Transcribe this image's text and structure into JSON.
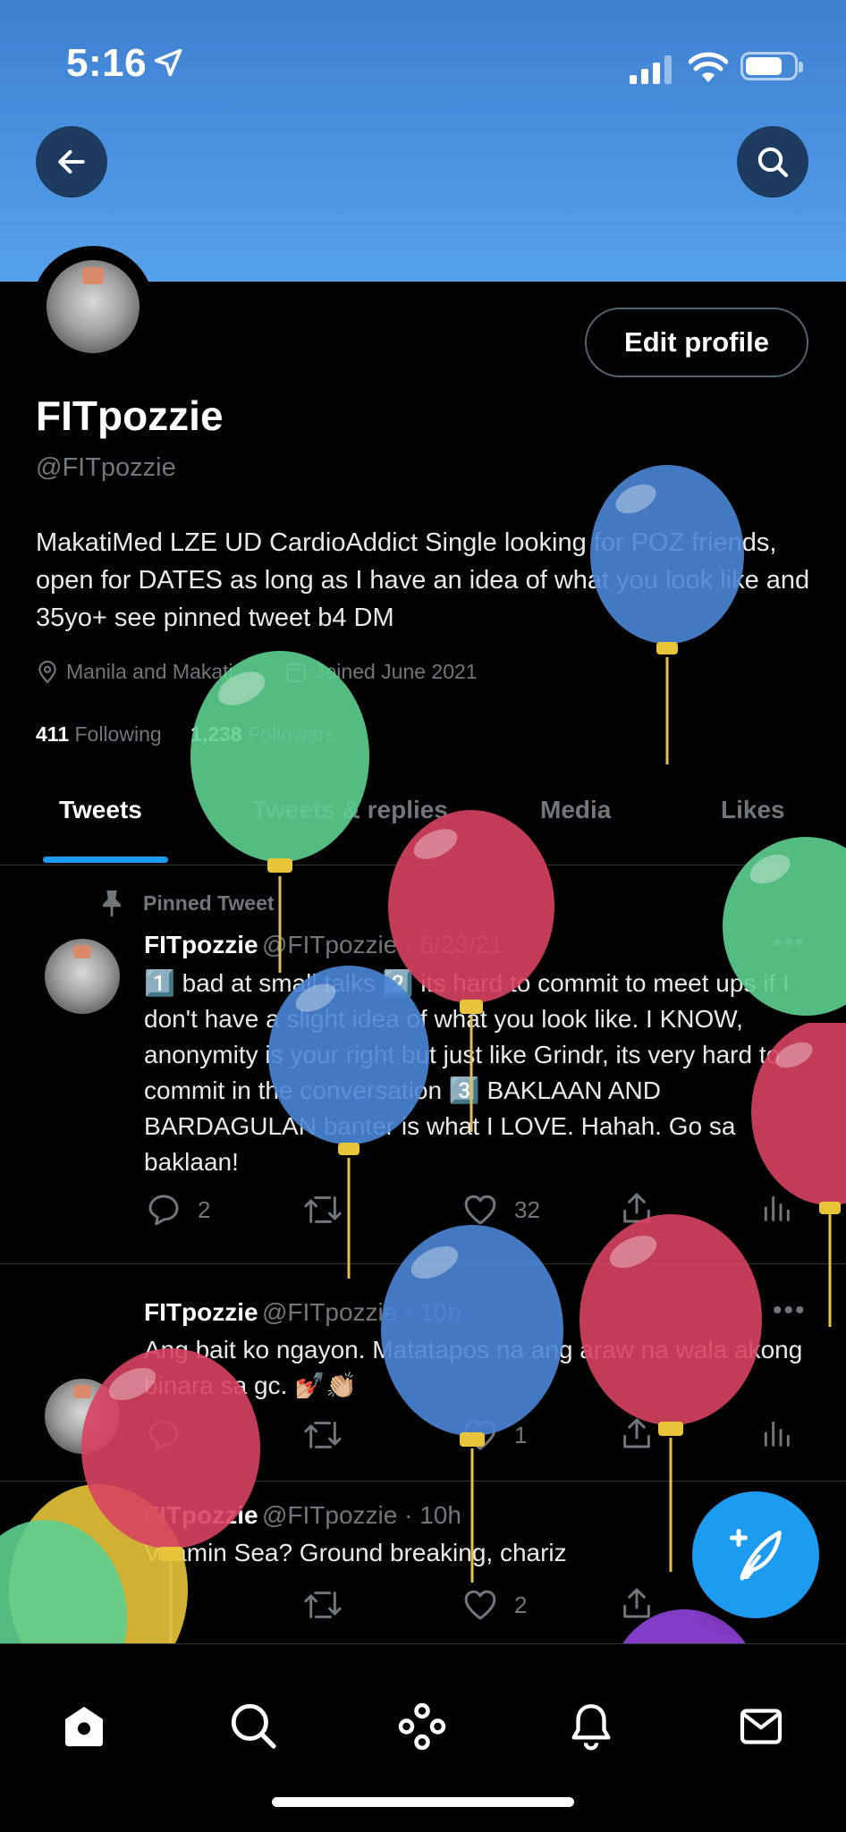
{
  "status_bar": {
    "time": "5:16"
  },
  "profile": {
    "display_name": "FITpozzie",
    "handle": "@FITpozzie",
    "edit_label": "Edit profile",
    "bio": "MakatiMed LZE UD CardioAddict Single looking for POZ friends, open for DATES as long as I have an idea of what you look like and 35yo+ see pinned tweet b4 DM",
    "location": "Manila and Makati",
    "joined": "Joined June 2021",
    "following_count": "411",
    "following_label": "Following",
    "followers_count": "1,238",
    "followers_label": "Followers"
  },
  "tabs": [
    "Tweets",
    "Tweets & replies",
    "Media",
    "Likes"
  ],
  "tweets": [
    {
      "pinned_label": "Pinned Tweet",
      "name": "FITpozzie",
      "handle_time": "@FITpozzie · 6/23/21",
      "text": "1️⃣ bad at small talks 2️⃣ its hard to commit to meet ups if I don't have a slight idea of what you look like. I KNOW, anonymity is your right but just like Grindr, its very hard to commit in the conversation 3️⃣ BAKLAAN AND BARDAGULAN banter is what I LOVE. Hahah. Go sa baklaan!",
      "replies": "2",
      "likes": "32"
    },
    {
      "name": "FITpozzie",
      "handle_time": "@FITpozzie · 10h",
      "text": "Ang bait ko ngayon. Matatapos na ang araw na wala akong binara sa gc. 💅🏼👏🏼",
      "replies": "",
      "likes": "1"
    },
    {
      "name": "FITpozzie",
      "handle_time": "@FITpozzie · 10h",
      "text": "Vitamin Sea? Ground breaking, chariz",
      "replies": "",
      "likes": "2"
    }
  ],
  "icons": {
    "back": "arrow-left-icon",
    "search": "search-icon",
    "location": "location-pin-icon",
    "calendar": "calendar-icon",
    "pin": "pin-icon",
    "compose": "compose-feather-icon"
  },
  "colors": {
    "accent": "#1d9bf0",
    "banner": "#4c94e2",
    "balloon_blue": "#4a86d6",
    "balloon_green": "#5dcf8f",
    "balloon_red": "#d84361",
    "balloon_yellow": "#e8c43a",
    "balloon_purple": "#8a3fd0"
  }
}
